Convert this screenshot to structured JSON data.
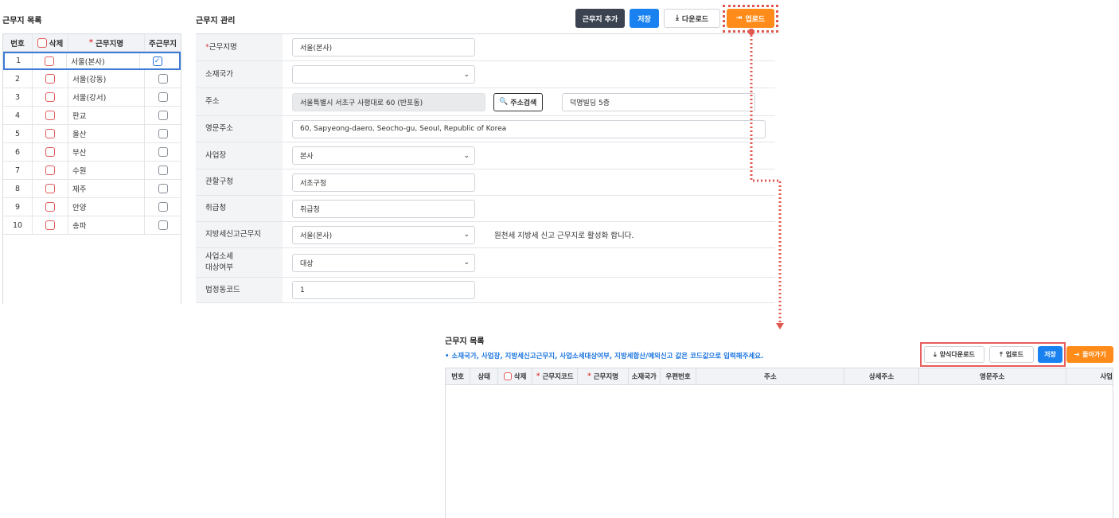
{
  "left_list": {
    "title": "근무지 목록",
    "headers": {
      "no": "번호",
      "delete": "삭제",
      "name": "근무지명",
      "main": "주근무지"
    },
    "rows": [
      {
        "no": "1",
        "name": "서울(본사)",
        "main": true
      },
      {
        "no": "2",
        "name": "서울(강동)",
        "main": false
      },
      {
        "no": "3",
        "name": "서울(강서)",
        "main": false
      },
      {
        "no": "4",
        "name": "판교",
        "main": false
      },
      {
        "no": "5",
        "name": "울산",
        "main": false
      },
      {
        "no": "6",
        "name": "부산",
        "main": false
      },
      {
        "no": "7",
        "name": "수원",
        "main": false
      },
      {
        "no": "8",
        "name": "제주",
        "main": false
      },
      {
        "no": "9",
        "name": "안양",
        "main": false
      },
      {
        "no": "10",
        "name": "송파",
        "main": false
      }
    ]
  },
  "form": {
    "title": "근무지 관리",
    "buttons": {
      "add": "근무지 추가",
      "save": "저장",
      "download": "다운로드",
      "upload": "업로드"
    },
    "fields": {
      "name_label": "근무지명",
      "name_value": "서울(본사)",
      "country_label": "소재국가",
      "country_value": "",
      "address_label": "주소",
      "address_value": "서울특별시 서초구 사평대로 60 (반포동)",
      "address_search": "주소검색",
      "address_detail": "덕명빌딩 5층",
      "eng_address_label": "영문주소",
      "eng_address_value": "60, Sapyeong-daero, Seocho-gu, Seoul, Republic of Korea",
      "site_label": "사업장",
      "site_value": "본사",
      "office_label": "관할구청",
      "office_value": "서초구청",
      "agency_label": "취급청",
      "agency_value": "취급청",
      "localtax_label": "지방세신고근무지",
      "localtax_value": "서울(본사)",
      "localtax_note": "원천세 지방세 신고 근무지로 활성화 합니다.",
      "bizsize_label_1": "사업소세",
      "bizsize_label_2": "대상여부",
      "bizsize_value": "대상",
      "legal_code_label": "법정동코드",
      "legal_code_value": "1"
    }
  },
  "upload_panel": {
    "title": "근무지 목록",
    "notice": "• 소재국가, 사업장, 지방세신고근무지, 사업소세대상여부, 지방세합산/예외신고 값은 코드값으로 입력해주세요.",
    "buttons": {
      "template_download": "양식다운로드",
      "upload": "업로드",
      "save": "저장",
      "back": "돌아가기"
    },
    "columns": [
      "번호",
      "상태",
      "삭제",
      "근무지코드",
      "근무지명",
      "소재국가",
      "우편번호",
      "주소",
      "상세주소",
      "영문주소",
      "사업"
    ]
  },
  "colors": {
    "accent_blue": "#1a82f0",
    "orange": "#ff8c1a",
    "highlight": "#e0574f"
  }
}
